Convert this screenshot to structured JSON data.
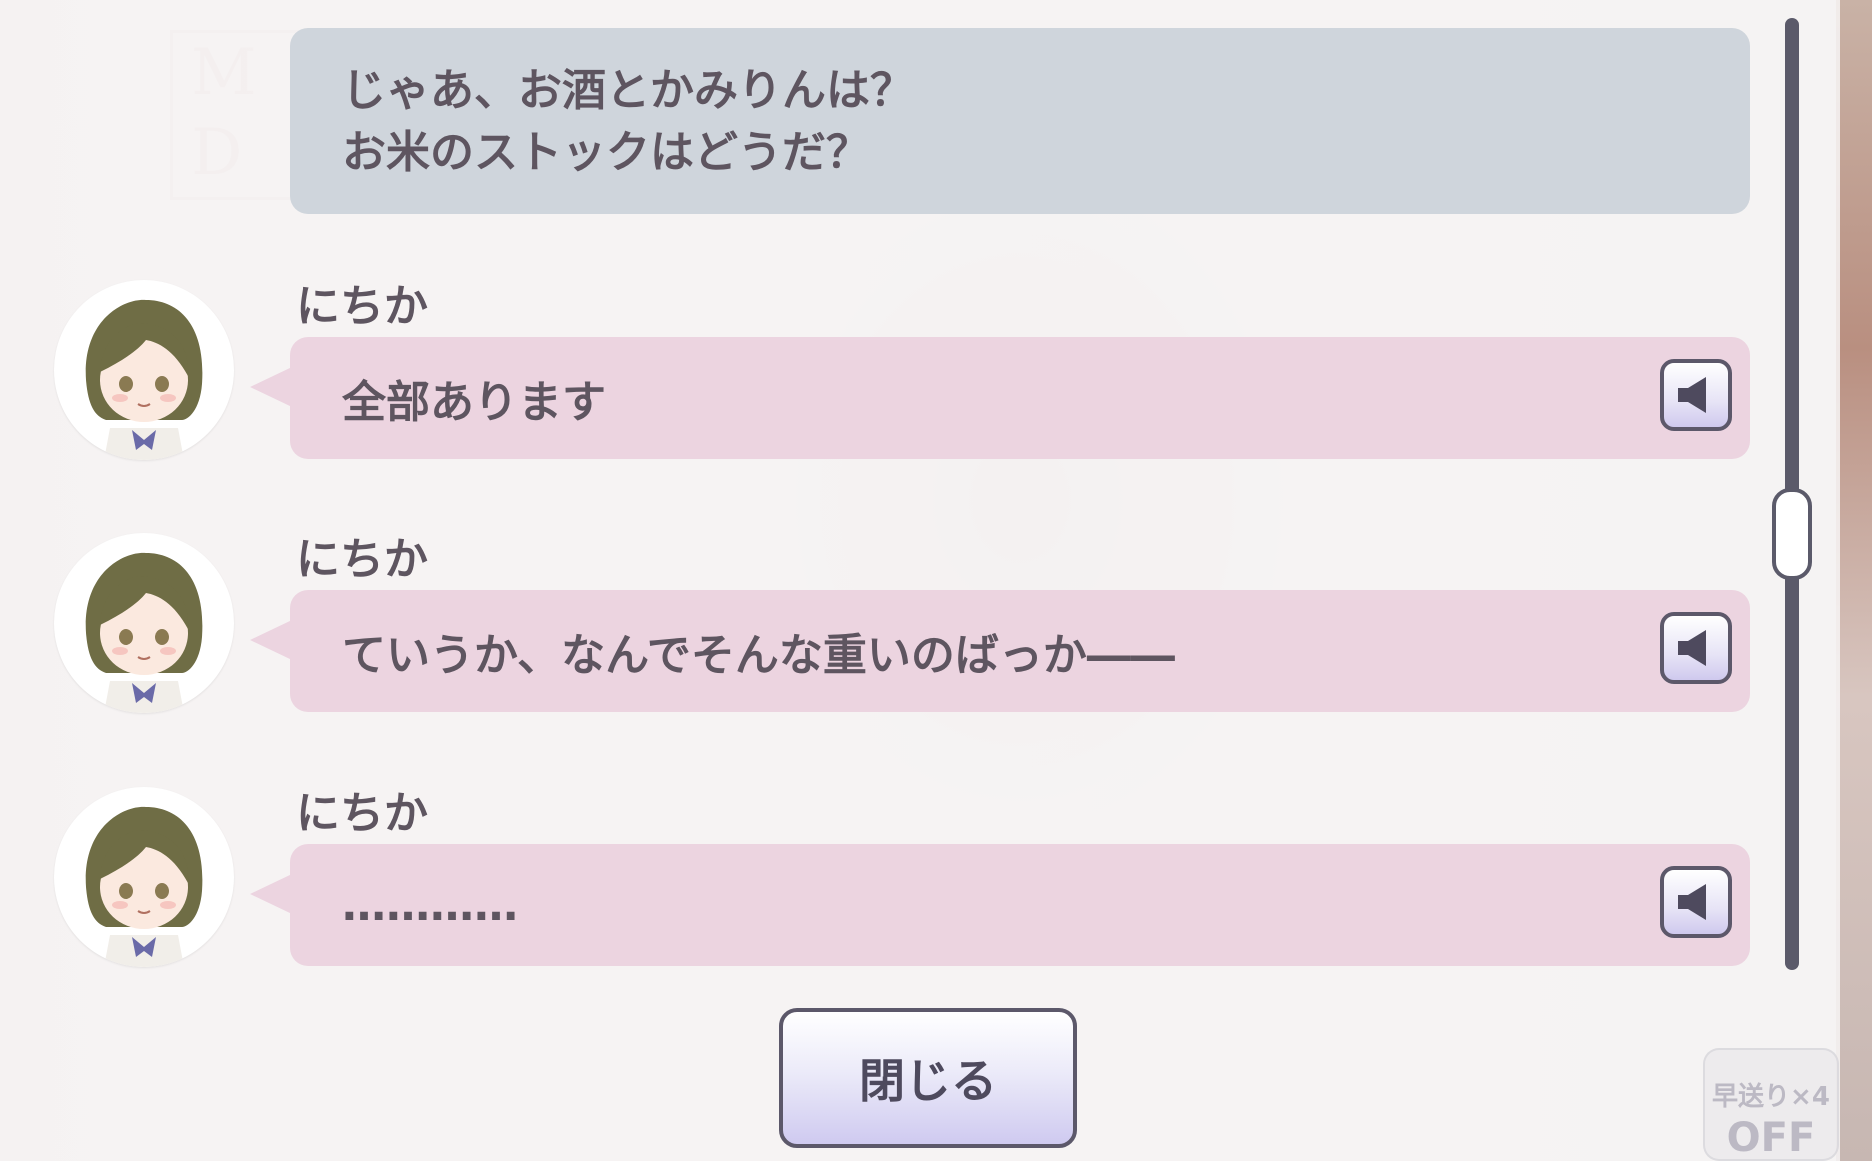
{
  "log": {
    "player_message": {
      "lines": [
        "じゃあ、お酒とかみりんは？",
        "お米のストックはどうだ？"
      ]
    },
    "entries": [
      {
        "speaker": "にちか",
        "text": "全部あります",
        "icon": "speaker-icon"
      },
      {
        "speaker": "にちか",
        "text": "ていうか、なんでそんな重いのばっか――",
        "icon": "speaker-icon"
      },
      {
        "speaker": "にちか",
        "text": "…………",
        "icon": "speaker-icon"
      }
    ]
  },
  "close_label": "閉じる",
  "fast_forward": {
    "label": "早送り×4",
    "state": "OFF"
  },
  "colors": {
    "player_bubble": "#cfd5dc",
    "character_bubble": "#ecd4e0",
    "text": "#5e5560",
    "hair": "#6f6d45",
    "accent": "#5b5a6a"
  }
}
